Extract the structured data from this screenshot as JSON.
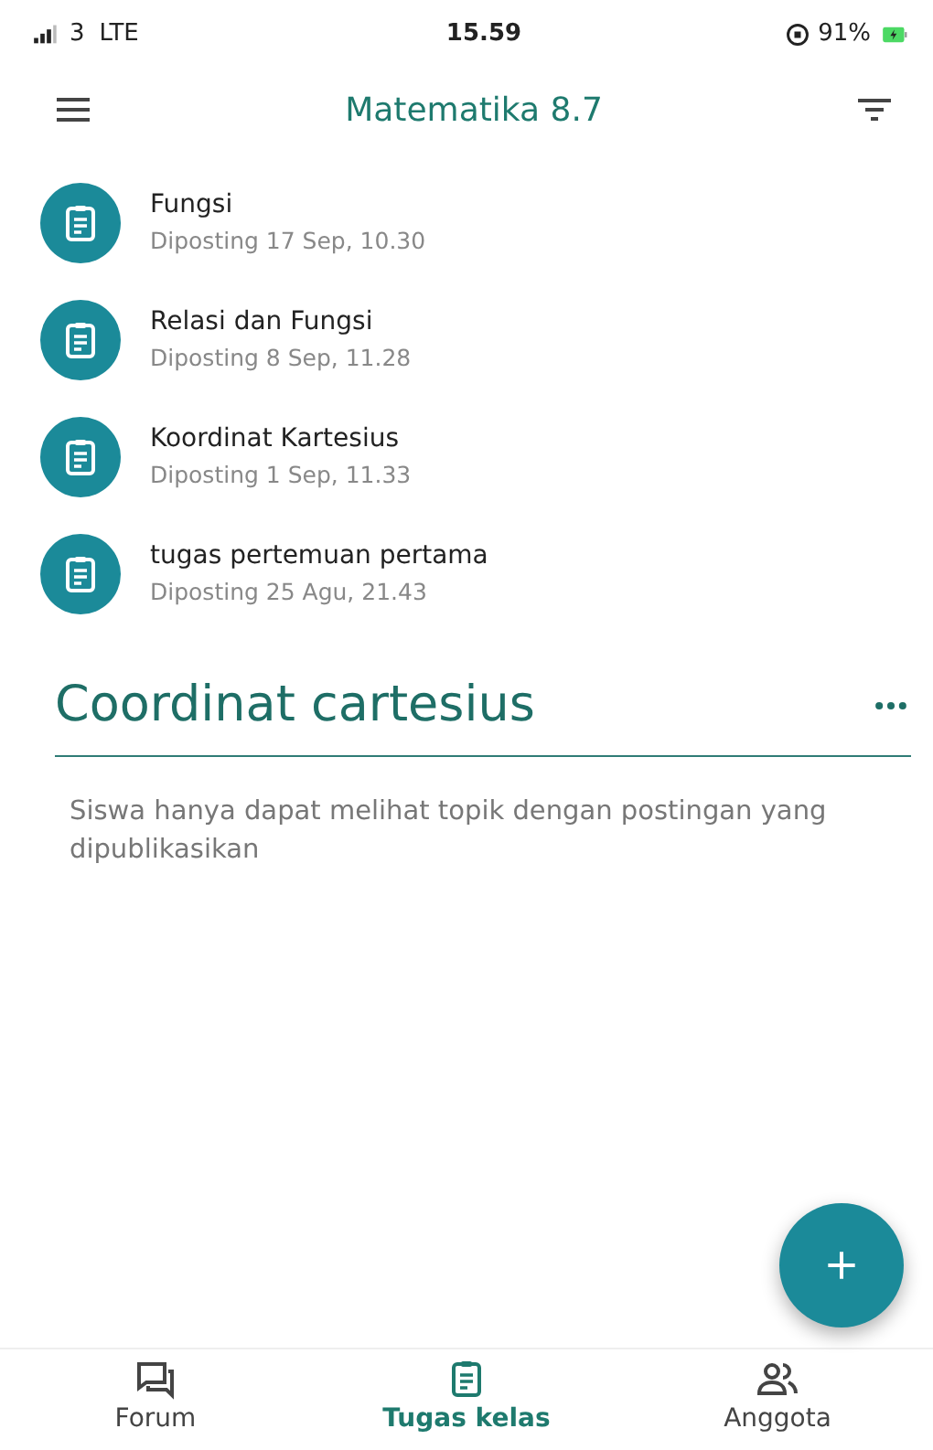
{
  "status_bar": {
    "carrier": "3",
    "network": "LTE",
    "time": "15.59",
    "battery_percent": "91%"
  },
  "app_bar": {
    "title": "Matematika 8.7"
  },
  "assignments": [
    {
      "title": "Fungsi",
      "posted": "Diposting 17 Sep, 10.30"
    },
    {
      "title": "Relasi dan Fungsi",
      "posted": "Diposting 8 Sep, 11.28"
    },
    {
      "title": "Koordinat Kartesius",
      "posted": "Diposting 1 Sep, 11.33"
    },
    {
      "title": "tugas pertemuan pertama",
      "posted": "Diposting 25 Agu, 21.43"
    }
  ],
  "topic": {
    "title": "Coordinat cartesius",
    "note": "Siswa hanya dapat melihat topik dengan postingan yang dipublikasikan"
  },
  "tabs": [
    {
      "kind": "forum",
      "label": "Forum",
      "selected": false
    },
    {
      "kind": "classwork",
      "label": "Tugas kelas",
      "selected": true
    },
    {
      "kind": "people",
      "label": "Anggota",
      "selected": false
    }
  ]
}
